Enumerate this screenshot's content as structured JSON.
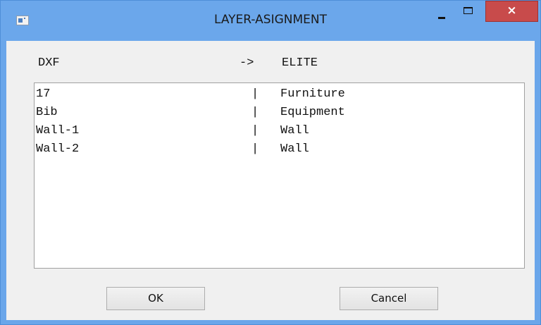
{
  "window": {
    "title": "LAYER-ASIGNMENT",
    "close_glyph": "×",
    "icons": {
      "app": "app-icon",
      "minimize": "minimize-icon",
      "maximize": "maximize-icon",
      "close": "close-icon"
    },
    "colors": {
      "titlebar": "#6ba7eb",
      "close_button": "#c84b4b",
      "client": "#f0f0f0"
    }
  },
  "header": {
    "left": "DXF",
    "arrow": "->",
    "right": "ELITE"
  },
  "mappings": [
    {
      "dxf": "17",
      "sep": "|",
      "elite": "Furniture"
    },
    {
      "dxf": "Bib",
      "sep": "|",
      "elite": "Equipment"
    },
    {
      "dxf": "Wall-1",
      "sep": "|",
      "elite": "Wall"
    },
    {
      "dxf": "Wall-2",
      "sep": "|",
      "elite": "Wall"
    }
  ],
  "buttons": {
    "ok": "OK",
    "cancel": "Cancel"
  }
}
